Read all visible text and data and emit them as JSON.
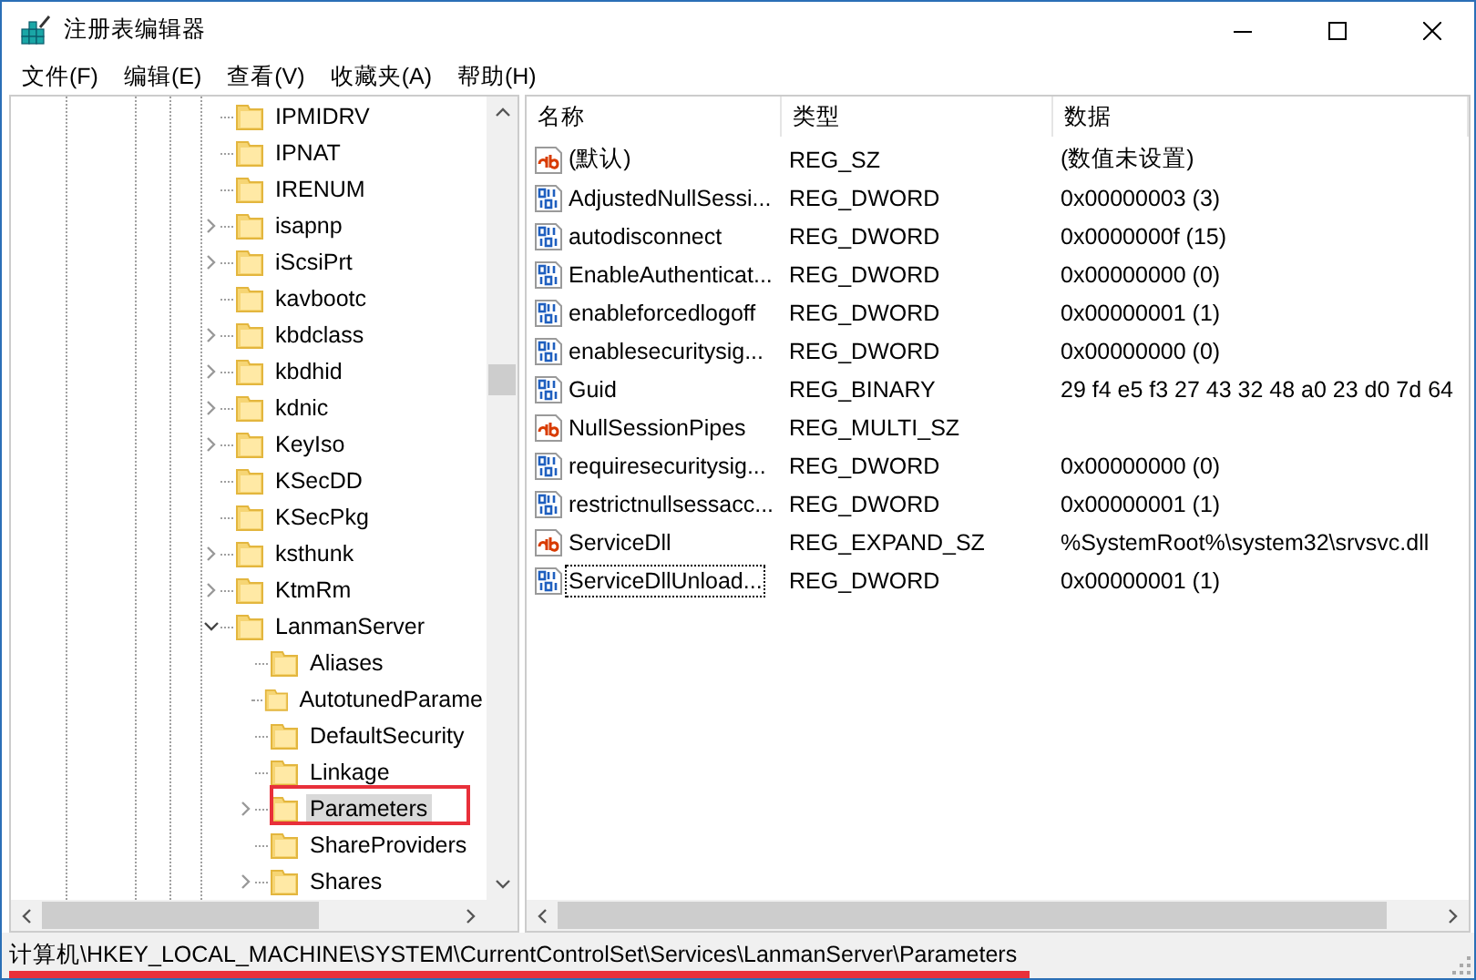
{
  "window": {
    "title": "注册表编辑器"
  },
  "menu": [
    "文件(F)",
    "编辑(E)",
    "查看(V)",
    "收藏夹(A)",
    "帮助(H)"
  ],
  "tree": [
    {
      "name": "IPMIDRV",
      "expandable": false,
      "selected": false
    },
    {
      "name": "IPNAT",
      "expandable": false,
      "selected": false
    },
    {
      "name": "IRENUM",
      "expandable": false,
      "selected": false
    },
    {
      "name": "isapnp",
      "expandable": true,
      "expanded": false,
      "selected": false
    },
    {
      "name": "iScsiPrt",
      "expandable": true,
      "expanded": false,
      "selected": false
    },
    {
      "name": "kavbootc",
      "expandable": false,
      "selected": false
    },
    {
      "name": "kbdclass",
      "expandable": true,
      "expanded": false,
      "selected": false
    },
    {
      "name": "kbdhid",
      "expandable": true,
      "expanded": false,
      "selected": false
    },
    {
      "name": "kdnic",
      "expandable": true,
      "expanded": false,
      "selected": false
    },
    {
      "name": "KeyIso",
      "expandable": true,
      "expanded": false,
      "selected": false
    },
    {
      "name": "KSecDD",
      "expandable": false,
      "selected": false
    },
    {
      "name": "KSecPkg",
      "expandable": false,
      "selected": false
    },
    {
      "name": "ksthunk",
      "expandable": true,
      "expanded": false,
      "selected": false
    },
    {
      "name": "KtmRm",
      "expandable": true,
      "expanded": false,
      "selected": false
    },
    {
      "name": "LanmanServer",
      "expandable": true,
      "expanded": true,
      "selected": false,
      "children": [
        {
          "name": "Aliases",
          "expandable": false,
          "selected": false
        },
        {
          "name": "AutotunedParame",
          "expandable": false,
          "selected": false
        },
        {
          "name": "DefaultSecurity",
          "expandable": false,
          "selected": false
        },
        {
          "name": "Linkage",
          "expandable": false,
          "selected": false
        },
        {
          "name": "Parameters",
          "expandable": true,
          "expanded": false,
          "selected": true,
          "highlighted": true
        },
        {
          "name": "ShareProviders",
          "expandable": false,
          "selected": false
        },
        {
          "name": "Shares",
          "expandable": true,
          "expanded": false,
          "selected": false
        }
      ]
    }
  ],
  "columns": [
    "名称",
    "类型",
    "数据"
  ],
  "values": [
    {
      "kind": "string",
      "name": "(默认)",
      "type": "REG_SZ",
      "data": "(数值未设置)",
      "focused": false
    },
    {
      "kind": "binary",
      "name": "AdjustedNullSessi...",
      "type": "REG_DWORD",
      "data": "0x00000003 (3)",
      "focused": false
    },
    {
      "kind": "binary",
      "name": "autodisconnect",
      "type": "REG_DWORD",
      "data": "0x0000000f (15)",
      "focused": false
    },
    {
      "kind": "binary",
      "name": "EnableAuthenticat...",
      "type": "REG_DWORD",
      "data": "0x00000000 (0)",
      "focused": false
    },
    {
      "kind": "binary",
      "name": "enableforcedlogoff",
      "type": "REG_DWORD",
      "data": "0x00000001 (1)",
      "focused": false
    },
    {
      "kind": "binary",
      "name": "enablesecuritysig...",
      "type": "REG_DWORD",
      "data": "0x00000000 (0)",
      "focused": false
    },
    {
      "kind": "binary",
      "name": "Guid",
      "type": "REG_BINARY",
      "data": "29 f4 e5 f3 27 43 32 48 a0 23 d0 7d 64",
      "focused": false
    },
    {
      "kind": "string",
      "name": "NullSessionPipes",
      "type": "REG_MULTI_SZ",
      "focused": false
    },
    {
      "kind": "binary",
      "name": "requiresecuritysig...",
      "type": "REG_DWORD",
      "data": "0x00000000 (0)",
      "focused": false
    },
    {
      "kind": "binary",
      "name": "restrictnullsessacc...",
      "type": "REG_DWORD",
      "data": "0x00000001 (1)",
      "focused": false
    },
    {
      "kind": "string",
      "name": "ServiceDll",
      "type": "REG_EXPAND_SZ",
      "data": "%SystemRoot%\\system32\\srvsvc.dll",
      "focused": false
    },
    {
      "kind": "binary",
      "name": "ServiceDllUnload...",
      "type": "REG_DWORD",
      "data": "0x00000001 (1)",
      "focused": true
    }
  ],
  "status_bar": {
    "path": "计算机\\HKEY_LOCAL_MACHINE\\SYSTEM\\CurrentControlSet\\Services\\LanmanServer\\Parameters",
    "underlined": true
  }
}
